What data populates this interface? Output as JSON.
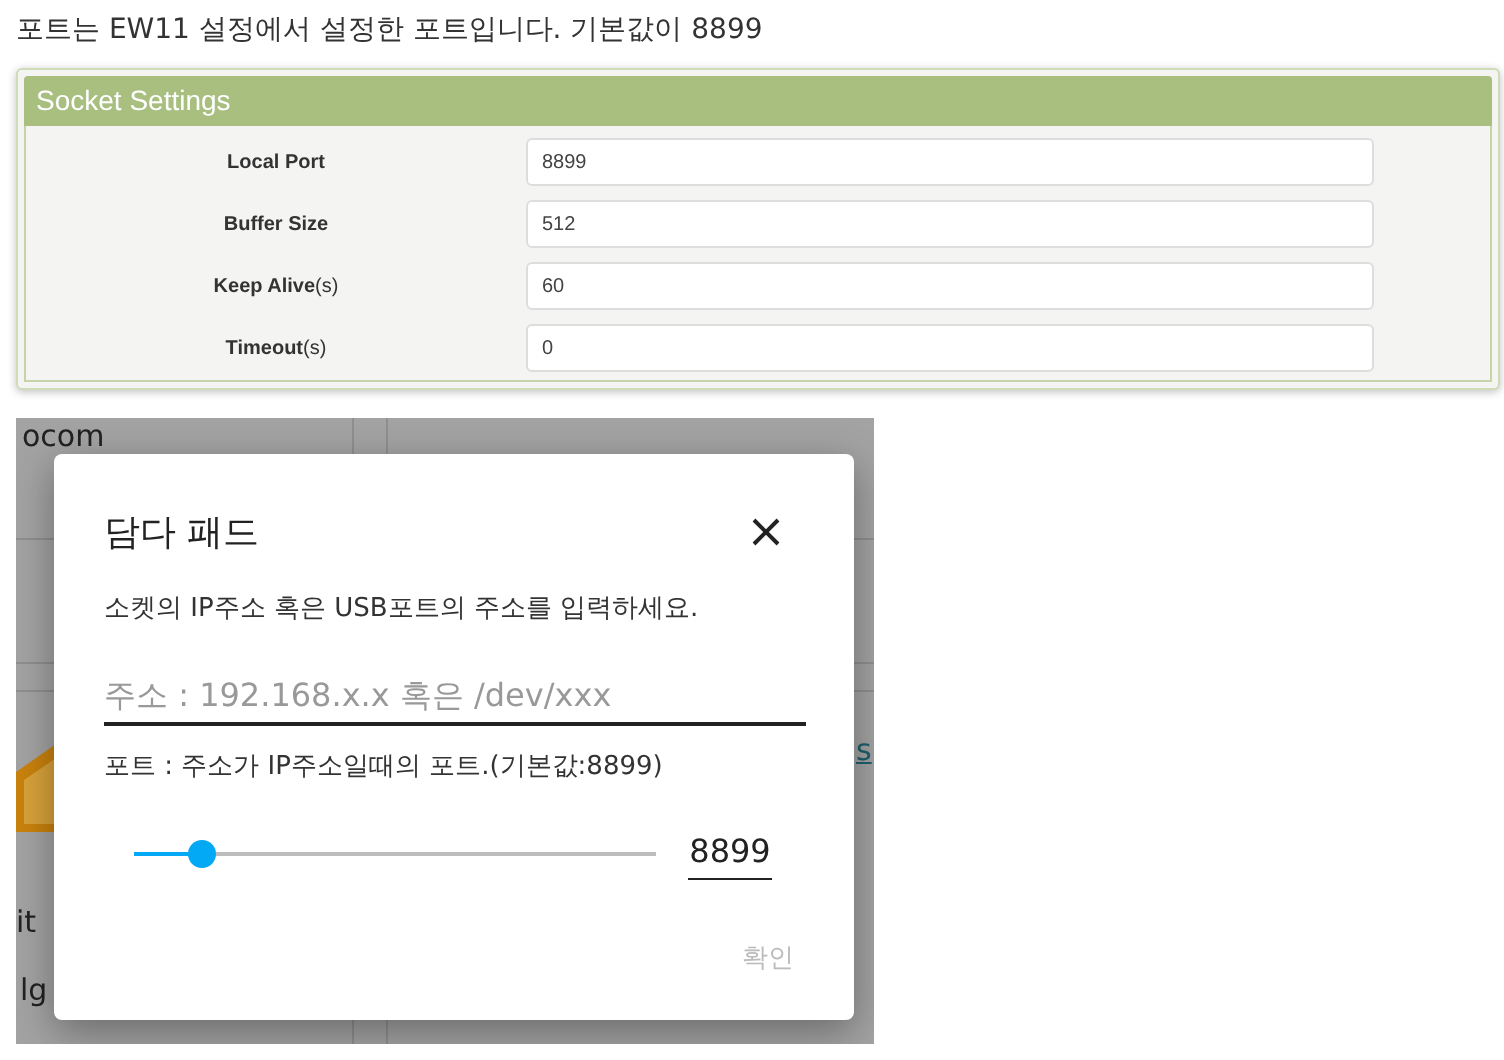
{
  "caption": "포트는 EW11 설정에서 설정한 포트입니다. 기본값이 8899",
  "socket_settings": {
    "title": "Socket Settings",
    "rows": [
      {
        "label": "Local Port",
        "unit": "",
        "value": "8899"
      },
      {
        "label": "Buffer Size",
        "unit": "",
        "value": "512"
      },
      {
        "label": "Keep Alive",
        "unit": "(s)",
        "value": "60"
      },
      {
        "label": "Timeout",
        "unit": "(s)",
        "value": "0"
      }
    ]
  },
  "background_fragments": [
    {
      "kind": "text",
      "text": "ocom"
    },
    {
      "kind": "link",
      "text": "s"
    },
    {
      "kind": "text",
      "text": "it"
    },
    {
      "kind": "text",
      "text": "lg"
    }
  ],
  "dialog": {
    "title": "담다 패드",
    "description": "소켓의 IP주소 혹은 USB포트의 주소를 입력하세요.",
    "address_field": {
      "placeholder": "주소 : 192.168.x.x 혹은 /dev/xxx"
    },
    "port_hint": "포트 : 주소가 IP주소일때의 포트.(기본값:8899)",
    "port_slider": {
      "level": 0.13,
      "value": "8899"
    },
    "confirm": {
      "label": "확인",
      "disabled": true
    }
  }
}
